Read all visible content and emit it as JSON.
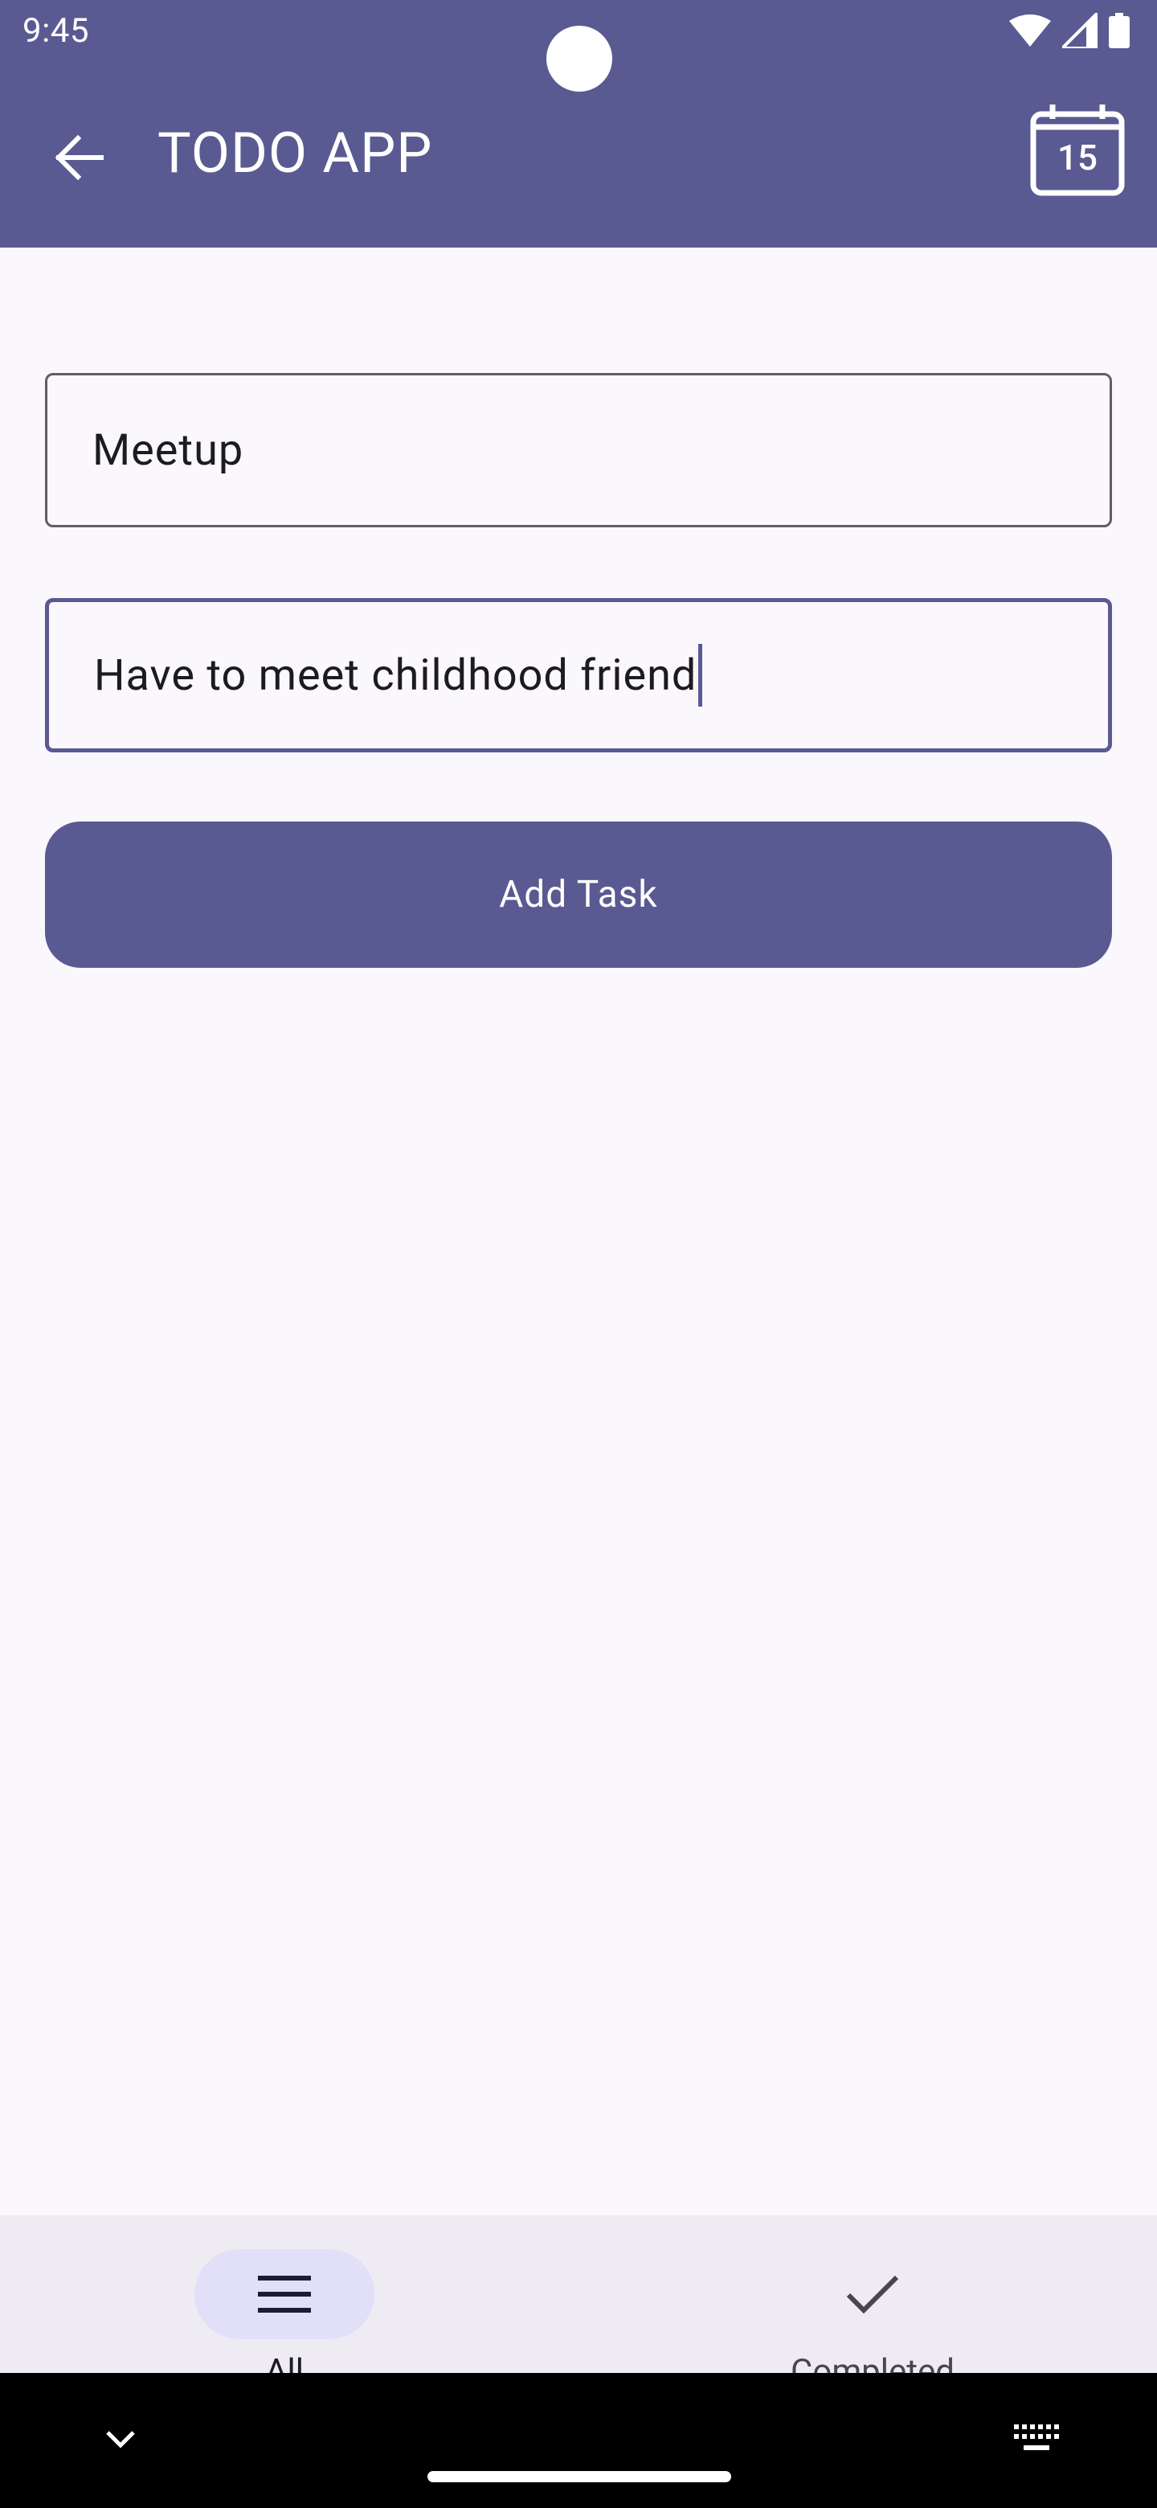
{
  "status_bar": {
    "time": "9:45"
  },
  "app_bar": {
    "title": "TODO APP",
    "calendar_day": "15"
  },
  "form": {
    "title_value": "Meetup",
    "description_value": "Have to meet childhood friend",
    "add_button_label": "Add Task"
  },
  "bottom_nav": {
    "items": [
      {
        "label": "All",
        "icon": "menu-icon",
        "active": true
      },
      {
        "label": "Completed",
        "icon": "check-icon",
        "active": false
      }
    ]
  },
  "colors": {
    "primary": "#5a5a92",
    "background": "#faf7fd",
    "nav_background": "#eeebf2",
    "active_pill": "#e2e0f9"
  }
}
